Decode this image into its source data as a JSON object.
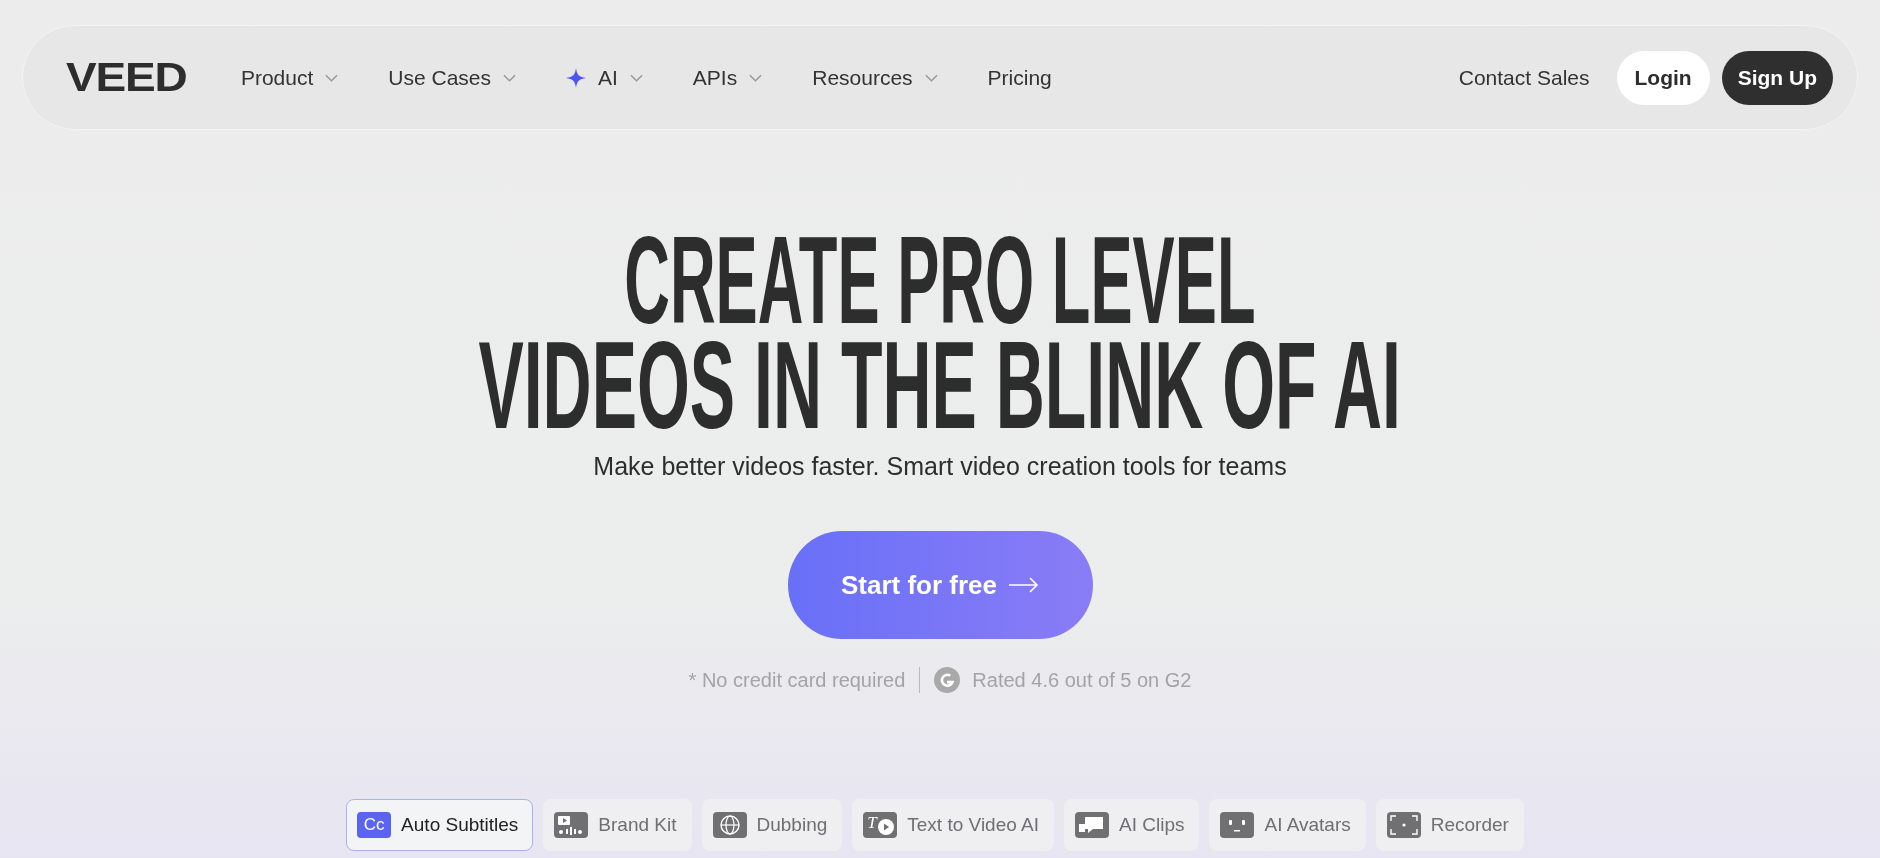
{
  "nav": {
    "logo": "VEED",
    "items": [
      {
        "label": "Product",
        "dropdown": true,
        "sparkle": false
      },
      {
        "label": "Use Cases",
        "dropdown": true,
        "sparkle": false
      },
      {
        "label": "AI",
        "dropdown": true,
        "sparkle": true
      },
      {
        "label": "APIs",
        "dropdown": true,
        "sparkle": false
      },
      {
        "label": "Resources",
        "dropdown": true,
        "sparkle": false
      },
      {
        "label": "Pricing",
        "dropdown": false,
        "sparkle": false
      }
    ],
    "contact": "Contact Sales",
    "login": "Login",
    "signup": "Sign Up"
  },
  "hero": {
    "headline": [
      "CREATE PRO LEVEL",
      "VIDEOS IN THE BLINK OF AI"
    ],
    "subtitle": "Make better videos faster. Smart video creation tools for teams",
    "cta": "Start for free",
    "note": "* No credit card required",
    "rating": "Rated 4.6 out of 5 on G2"
  },
  "features": [
    {
      "kind": "subtitles",
      "icon_text": "Cc",
      "label": "Auto Subtitles",
      "selected": true
    },
    {
      "kind": "brand",
      "label": "Brand Kit",
      "selected": false
    },
    {
      "kind": "dubbing",
      "label": "Dubbing",
      "selected": false
    },
    {
      "kind": "text-video",
      "icon_text": "T",
      "label": "Text to Video AI",
      "selected": false
    },
    {
      "kind": "clips",
      "label": "AI Clips",
      "selected": false
    },
    {
      "kind": "avatars",
      "label": "AI Avatars",
      "selected": false
    },
    {
      "kind": "recorder",
      "label": "Recorder",
      "selected": false
    }
  ]
}
